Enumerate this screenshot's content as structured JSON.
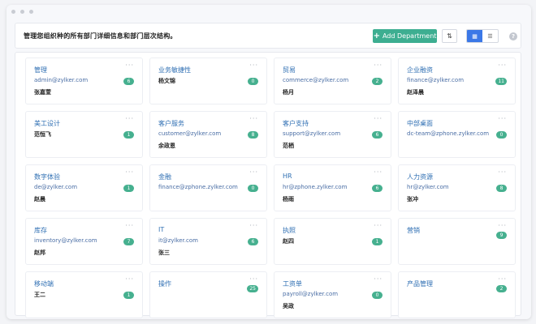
{
  "header": {
    "description": "管理您组织种的所有部门详细信息和部门层次结构。",
    "add_button_label": "Add Department",
    "sort_icon": "sort-arrows-icon",
    "grid_view_icon": "grid-view-icon",
    "list_view_icon": "list-view-icon",
    "help_icon": "question-circle-icon",
    "help_glyph": "?"
  },
  "colors": {
    "accent": "#3dae91",
    "view_active": "#3b78e7",
    "badge": "#46b08f",
    "dept_name": "#2f6fb3"
  },
  "departments": [
    {
      "name": "管理",
      "email": "admin@zylker.com",
      "count": "6",
      "head": "张嘉萱"
    },
    {
      "name": "业务敏捷性",
      "email": "",
      "count": "0",
      "head": "杨文锦"
    },
    {
      "name": "贸易",
      "email": "commerce@zylker.com",
      "count": "2",
      "head": "杨月"
    },
    {
      "name": "企业融资",
      "email": "finance@zylker.com",
      "count": "11",
      "head": "赵泽晨"
    },
    {
      "name": "美工设计",
      "email": "",
      "count": "1",
      "head": "范恒飞"
    },
    {
      "name": "客户服务",
      "email": "customer@zylker.com",
      "count": "8",
      "head": "余政恩"
    },
    {
      "name": "客户支持",
      "email": "support@zylker.com",
      "count": "6",
      "head": "范栖"
    },
    {
      "name": "中部桌面",
      "email": "dc-team@zphone.zylker.com",
      "count": "0",
      "head": ""
    },
    {
      "name": "数字体验",
      "email": "de@zylker.com",
      "count": "1",
      "head": "赵晨"
    },
    {
      "name": "金融",
      "email": "finance@zphone.zylker.com",
      "count": "0",
      "head": ""
    },
    {
      "name": "HR",
      "email": "hr@zphone.zylker.com",
      "count": "6",
      "head": "杨雨"
    },
    {
      "name": "人力资源",
      "email": "hr@zylker.com",
      "count": "8",
      "head": "张冲"
    },
    {
      "name": "库存",
      "email": "inventory@zylker.com",
      "count": "7",
      "head": "赵邦"
    },
    {
      "name": "IT",
      "email": "it@zylker.com",
      "count": "6",
      "head": "张三"
    },
    {
      "name": "执照",
      "email": "",
      "count": "1",
      "head": "赵四"
    },
    {
      "name": "营销",
      "email": "",
      "count": "9",
      "head": ""
    },
    {
      "name": "移动端",
      "email": "",
      "count": "1",
      "head": "王二"
    },
    {
      "name": "操作",
      "email": "",
      "count": "25",
      "head": ""
    },
    {
      "name": "工资单",
      "email": "payroll@zylker.com",
      "count": "0",
      "head": "吴政"
    },
    {
      "name": "产品管理",
      "email": "",
      "count": "2",
      "head": ""
    }
  ],
  "card_more_label": "···"
}
